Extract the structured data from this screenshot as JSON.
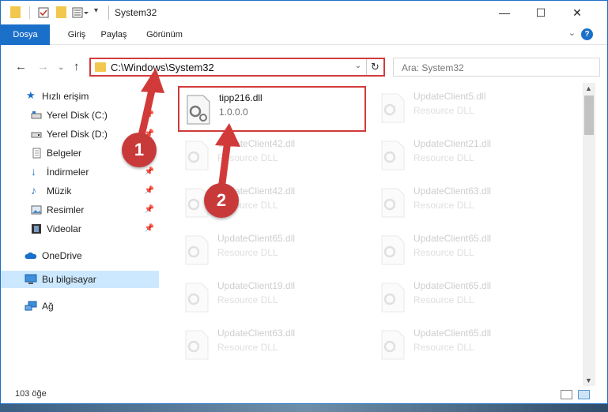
{
  "window": {
    "title": "System32",
    "controls": {
      "minimize": "—",
      "maximize": "☐",
      "close": "✕"
    }
  },
  "ribbon": {
    "tabs": [
      "Dosya",
      "Giriş",
      "Paylaş",
      "Görünüm"
    ],
    "help": "?"
  },
  "address": {
    "path": "C:\\Windows\\System32",
    "search_placeholder": "Ara: System32"
  },
  "nav": {
    "items": [
      {
        "label": "Hızlı erişim",
        "icon": "star-icon"
      },
      {
        "label": "Yerel Disk (C:)",
        "icon": "drive-icon",
        "pinned": true
      },
      {
        "label": "Yerel Disk (D:)",
        "icon": "drive-icon",
        "pinned": true
      },
      {
        "label": "Belgeler",
        "icon": "documents-icon",
        "pinned": true
      },
      {
        "label": "İndirmeler",
        "icon": "downloads-icon",
        "pinned": true
      },
      {
        "label": "Müzik",
        "icon": "music-icon",
        "pinned": true
      },
      {
        "label": "Resimler",
        "icon": "pictures-icon",
        "pinned": true
      },
      {
        "label": "Videolar",
        "icon": "videos-icon",
        "pinned": true
      },
      {
        "label": "OneDrive",
        "icon": "cloud-icon"
      },
      {
        "label": "Bu bilgisayar",
        "icon": "computer-icon",
        "selected": true
      },
      {
        "label": "Ağ",
        "icon": "network-icon"
      }
    ],
    "pin_glyph": "📌"
  },
  "files": [
    {
      "name": "tipp216.dll",
      "sub": "1.0.0.0",
      "highlight": true
    },
    {
      "name": "UpdateClient5.dll",
      "sub": "Resource DLL"
    },
    {
      "name": "UpdateClient42.dll",
      "sub": "Resource DLL"
    },
    {
      "name": "UpdateClient21.dll",
      "sub": "Resource DLL"
    },
    {
      "name": "UpdateClient42.dll",
      "sub": "Resource DLL"
    },
    {
      "name": "UpdateClient63.dll",
      "sub": "Resource DLL"
    },
    {
      "name": "UpdateClient65.dll",
      "sub": "Resource DLL"
    },
    {
      "name": "UpdateClient65.dll",
      "sub": "Resource DLL"
    },
    {
      "name": "UpdateClient19.dll",
      "sub": "Resource DLL"
    },
    {
      "name": "UpdateClient65.dll",
      "sub": "Resource DLL"
    },
    {
      "name": "UpdateClient63.dll",
      "sub": "Resource DLL"
    },
    {
      "name": "UpdateClient65.dll",
      "sub": "Resource DLL"
    }
  ],
  "status": {
    "count": "103 öğe"
  },
  "annotations": {
    "step1": "1",
    "step2": "2"
  },
  "colors": {
    "accent": "#1a6fc9",
    "highlight": "#d23a3a",
    "badge": "#c83a3a"
  }
}
